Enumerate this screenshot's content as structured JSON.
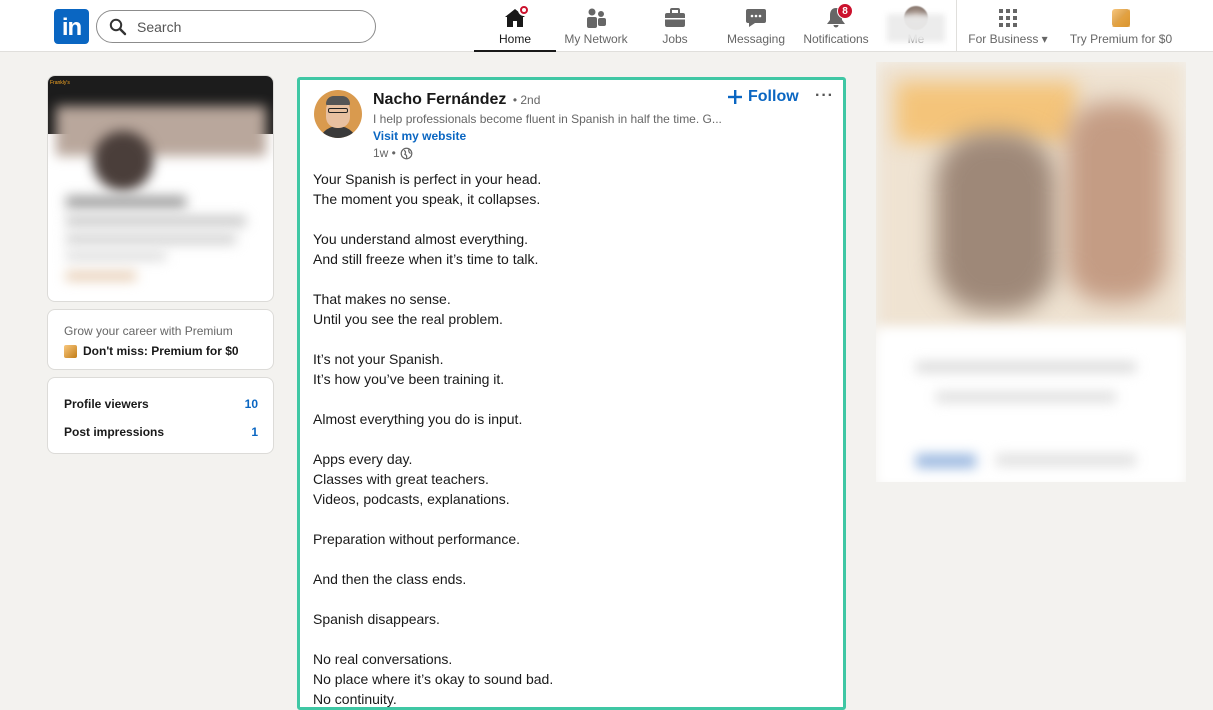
{
  "nav": {
    "logo_text": "in",
    "search_placeholder": "Search",
    "items": [
      {
        "label": "Home",
        "icon": "home-icon"
      },
      {
        "label": "My Network",
        "icon": "network-icon"
      },
      {
        "label": "Jobs",
        "icon": "briefcase-icon"
      },
      {
        "label": "Messaging",
        "icon": "chat-icon"
      },
      {
        "label": "Notifications",
        "icon": "bell-icon",
        "badge": "8"
      },
      {
        "label": "Me",
        "icon": "avatar"
      },
      {
        "label": "For Business",
        "icon": "grid-icon"
      },
      {
        "label": "Try Premium for $0",
        "icon": "premium-icon"
      }
    ]
  },
  "left": {
    "banner_text": "Frankly's",
    "premium": {
      "subtitle": "Grow your career with Premium",
      "link": "Don't miss: Premium for $0"
    },
    "stats": [
      {
        "label": "Profile viewers",
        "value": "10"
      },
      {
        "label": "Post impressions",
        "value": "1"
      }
    ]
  },
  "post": {
    "author": "Nacho Fernández",
    "degree": "• 2nd",
    "headline": "I help professionals become fluent in Spanish in half the time. G...",
    "website": "Visit my website",
    "time": "1w •",
    "follow_label": "Follow",
    "more_label": "···",
    "paragraphs": [
      [
        "Your Spanish is perfect in your head.",
        "The moment you speak, it collapses."
      ],
      [
        "You understand almost everything.",
        "And still freeze when it’s time to talk."
      ],
      [
        "That makes no sense.",
        "Until you see the real problem."
      ],
      [
        "It’s not your Spanish.",
        "It’s how you’ve been training it."
      ],
      [
        "Almost everything you do is input."
      ],
      [
        "Apps every day.",
        "Classes with great teachers.",
        "Videos, podcasts, explanations."
      ],
      [
        "Preparation without performance."
      ],
      [
        "And then the class ends."
      ],
      [
        "Spanish disappears."
      ],
      [
        "No real conversations.",
        "No place where it’s okay to sound bad.",
        "No continuity."
      ]
    ]
  },
  "colors": {
    "brand": "#0a66c2",
    "highlight": "#3fc7a4",
    "badge": "#cb112d"
  }
}
